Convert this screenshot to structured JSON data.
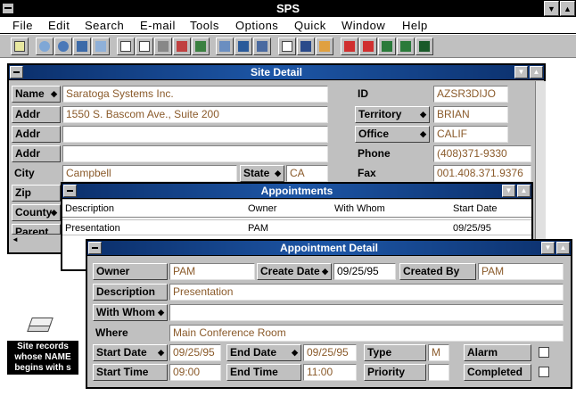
{
  "app": {
    "title": "SPS"
  },
  "menu": [
    "File",
    "Edit",
    "Search",
    "E-mail",
    "Tools",
    "Options",
    "Quick",
    "Window",
    "Help"
  ],
  "toolbar_icons": [
    "record-icon",
    "search-icon",
    "find-icon",
    "find-next-icon",
    "browse-icon",
    "form-icon",
    "list-icon",
    "print-icon",
    "phone-icon",
    "mail-icon",
    "picture-icon",
    "calendar-icon",
    "schedule-icon",
    "appointment-icon",
    "notes-icon",
    "book-icon",
    "undo-icon",
    "redo-icon",
    "import-icon",
    "export-icon",
    "exit-icon"
  ],
  "site_detail": {
    "title": "Site Detail",
    "name_label": "Name",
    "name_value": "Saratoga Systems Inc.",
    "addr_label": "Addr",
    "addr1_value": "1550 S. Bascom Ave., Suite 200",
    "addr2_value": "",
    "addr3_value": "",
    "city_label": "City",
    "city_value": "Campbell",
    "state_label": "State",
    "state_value": "CA",
    "zip_label": "Zip",
    "county_label": "County",
    "parent_label": "Parent",
    "id_label": "ID",
    "id_value": "AZSR3DIJO",
    "territory_label": "Territory",
    "territory_value": "BRIAN",
    "office_label": "Office",
    "office_value": "CALIF",
    "phone_label": "Phone",
    "phone_value": "(408)371-9330",
    "fax_label": "Fax",
    "fax_value": "001.408.371.9376"
  },
  "appointments": {
    "title": "Appointments",
    "columns": [
      "Description",
      "Owner",
      "With Whom",
      "Start Date"
    ],
    "rows": [
      {
        "description": "Presentation",
        "owner": "PAM",
        "with_whom": "",
        "start_date": "09/25/95"
      }
    ]
  },
  "appointment_detail": {
    "title": "Appointment Detail",
    "owner_label": "Owner",
    "owner_value": "PAM",
    "create_date_label": "Create Date",
    "create_date_value": "09/25/95",
    "created_by_label": "Created By",
    "created_by_value": "PAM",
    "description_label": "Description",
    "description_value": "Presentation",
    "with_whom_label": "With Whom",
    "with_whom_value": "",
    "where_label": "Where",
    "where_value": "Main Conference Room",
    "start_date_label": "Start Date",
    "start_date_value": "09/25/95",
    "end_date_label": "End Date",
    "end_date_value": "09/25/95",
    "type_label": "Type",
    "type_value": "M",
    "alarm_label": "Alarm",
    "start_time_label": "Start Time",
    "start_time_value": "09:00",
    "end_time_label": "End Time",
    "end_time_value": "11:00",
    "priority_label": "Priority",
    "priority_value": "",
    "completed_label": "Completed"
  },
  "desktop_icon": {
    "label": "Site records whose NAME begins with s"
  },
  "colors": {
    "title_blue": "#1d56a6",
    "window_gray": "#c0c0c0",
    "field_text": "#8a5a2a"
  }
}
